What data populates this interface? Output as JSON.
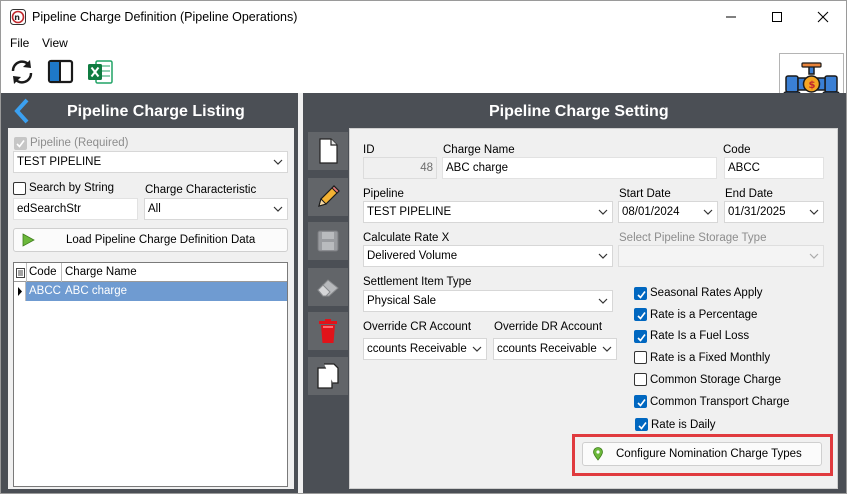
{
  "window": {
    "title": "Pipeline Charge Definition (Pipeline Operations)",
    "controls": [
      "minimize",
      "maximize",
      "close"
    ]
  },
  "menu": {
    "items": [
      "File",
      "View"
    ]
  },
  "toolbar": {
    "icons": [
      "refresh-icon",
      "split-view-icon",
      "excel-icon"
    ]
  },
  "left_panel": {
    "header": "Pipeline Charge Listing",
    "pipeline_label": "Pipeline (Required)",
    "pipeline_value": "TEST PIPELINE",
    "search_by_string_label": "Search by String",
    "search_input_value": "edSearchStr",
    "charge_characteristic_label": "Charge Characteristic",
    "charge_characteristic_value": "All",
    "load_button_label": "Load Pipeline Charge Definition Data",
    "grid": {
      "columns": [
        "Code",
        "Charge Name"
      ],
      "rows": [
        {
          "code": "ABCC",
          "name": "ABC charge"
        }
      ]
    }
  },
  "right_panel": {
    "header": "Pipeline Charge Setting",
    "side_tools": [
      "new-document-icon",
      "edit-pencil-icon",
      "save-disk-icon",
      "eraser-icon",
      "delete-trash-icon",
      "copy-icon"
    ],
    "id_label": "ID",
    "id_value": "48",
    "charge_name_label": "Charge Name",
    "charge_name_value": "ABC charge",
    "code_label": "Code",
    "code_value": "ABCC",
    "pipeline_label": "Pipeline",
    "pipeline_value": "TEST PIPELINE",
    "start_date_label": "Start Date",
    "start_date_value": "08/01/2024",
    "end_date_label": "End Date",
    "end_date_value": "01/31/2025",
    "calc_rate_label": "Calculate Rate X",
    "calc_rate_value": "Delivered Volume",
    "storage_type_label": "Select Pipeline Storage Type",
    "storage_type_value": "",
    "settlement_label": "Settlement Item Type",
    "settlement_value": "Physical Sale",
    "override_cr_label": "Override CR Account",
    "override_cr_value": "ccounts Receivable",
    "override_dr_label": "Override DR Account",
    "override_dr_value": "ccounts Receivable",
    "checkboxes": [
      {
        "label": "Seasonal Rates Apply",
        "checked": true
      },
      {
        "label": "Rate is a Percentage",
        "checked": true
      },
      {
        "label": "Rate Is a Fuel Loss",
        "checked": true
      },
      {
        "label": "Rate is a Fixed Monthly",
        "checked": false
      },
      {
        "label": "Common Storage Charge",
        "checked": false
      },
      {
        "label": "Common Transport Charge",
        "checked": true
      },
      {
        "label": "Rate is Daily",
        "checked": true
      }
    ],
    "configure_button_label": "Configure Nomination Charge Types"
  },
  "colors": {
    "panel_bg": "#4b4f55",
    "accent_blue": "#0067c0",
    "highlight_red": "#e03a3e",
    "selected_row": "#6f9bd1"
  }
}
